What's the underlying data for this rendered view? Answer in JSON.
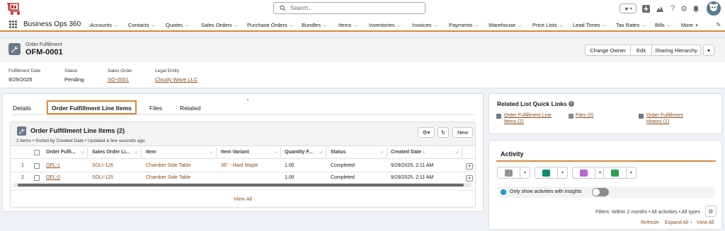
{
  "header": {
    "search_placeholder": "Search..."
  },
  "nav": {
    "app_name": "Business Ops 360",
    "items": [
      {
        "label": "Accounts"
      },
      {
        "label": "Contacts"
      },
      {
        "label": "Quotes"
      },
      {
        "label": "Sales Orders"
      },
      {
        "label": "Purchase Orders"
      },
      {
        "label": "Bundles"
      },
      {
        "label": "Items"
      },
      {
        "label": "Inventories"
      },
      {
        "label": "Invoices"
      },
      {
        "label": "Payments"
      },
      {
        "label": "Warehouse"
      },
      {
        "label": "Price Lists"
      },
      {
        "label": "Lead Times"
      },
      {
        "label": "Tax Rates"
      },
      {
        "label": "Bills"
      },
      {
        "label": "More"
      }
    ]
  },
  "record": {
    "object_label": "Order Fulfillment",
    "name": "OFM-0001",
    "actions": {
      "change_owner": "Change Owner",
      "edit": "Edit",
      "sharing_hierarchy": "Sharing Hierarchy"
    },
    "fields": [
      {
        "label": "Fulfillment Date",
        "value": "9/29/2025",
        "link": false
      },
      {
        "label": "Status",
        "value": "Pending",
        "link": false
      },
      {
        "label": "Sales Order",
        "value": "SO-0001",
        "link": true
      },
      {
        "label": "Legal Entity",
        "value": "Cloudy Wave LLC",
        "link": true
      }
    ]
  },
  "tabs": [
    {
      "label": "Details",
      "active": false
    },
    {
      "label": "Order Fulfillment Line Items",
      "active": true
    },
    {
      "label": "Files",
      "active": false
    },
    {
      "label": "Related",
      "active": false
    }
  ],
  "related_list": {
    "title": "Order Fulfillment Line Items (2)",
    "subtitle": "2 items • Sorted by Created Date • Updated a few seconds ago",
    "new_button": "New",
    "columns": [
      "Order Fulfi...",
      "Sales Order Li...",
      "Item",
      "Item Variant",
      "Quantity F...",
      "Status",
      "Created Date ↓"
    ],
    "rows": [
      {
        "num": "1",
        "order_fulfillment": "OFL-1",
        "sales_order_line": "SOLI-126",
        "item": "Chamber Side Table",
        "item_variant": "36\" - Hard Maple",
        "quantity": "1.00",
        "status": "Completed",
        "created_date": "9/29/2025, 2:11 AM"
      },
      {
        "num": "2",
        "order_fulfillment": "OFL-0",
        "sales_order_line": "SOLI-125",
        "item": "Chamber Side Table",
        "item_variant": "",
        "quantity": "1.00",
        "status": "Completed",
        "created_date": "9/29/2025, 2:11 AM"
      }
    ],
    "view_all": "View All"
  },
  "quick_links": {
    "title": "Related List Quick Links",
    "links": [
      {
        "label_line1": "Order Fulfillment Line",
        "label_line2": "Items (2)"
      },
      {
        "label_line1": "Files (0)",
        "label_line2": ""
      },
      {
        "label_line1": "Order Fulfillment",
        "label_line2": "History (1)"
      }
    ]
  },
  "activity": {
    "title": "Activity",
    "insights_label": "Only show activities with insights",
    "filters_text": "Filters: Within 2 months • All activities • All types",
    "links": {
      "refresh": "Refresh",
      "expand_all": "Expand All",
      "view_all": "View All"
    }
  },
  "colors": {
    "accent": "#d38a3e",
    "link": "#8a4b1c",
    "email": "#939393",
    "event": "#0b8f76",
    "task": "#b867d6",
    "log": "#2e9e4f"
  }
}
